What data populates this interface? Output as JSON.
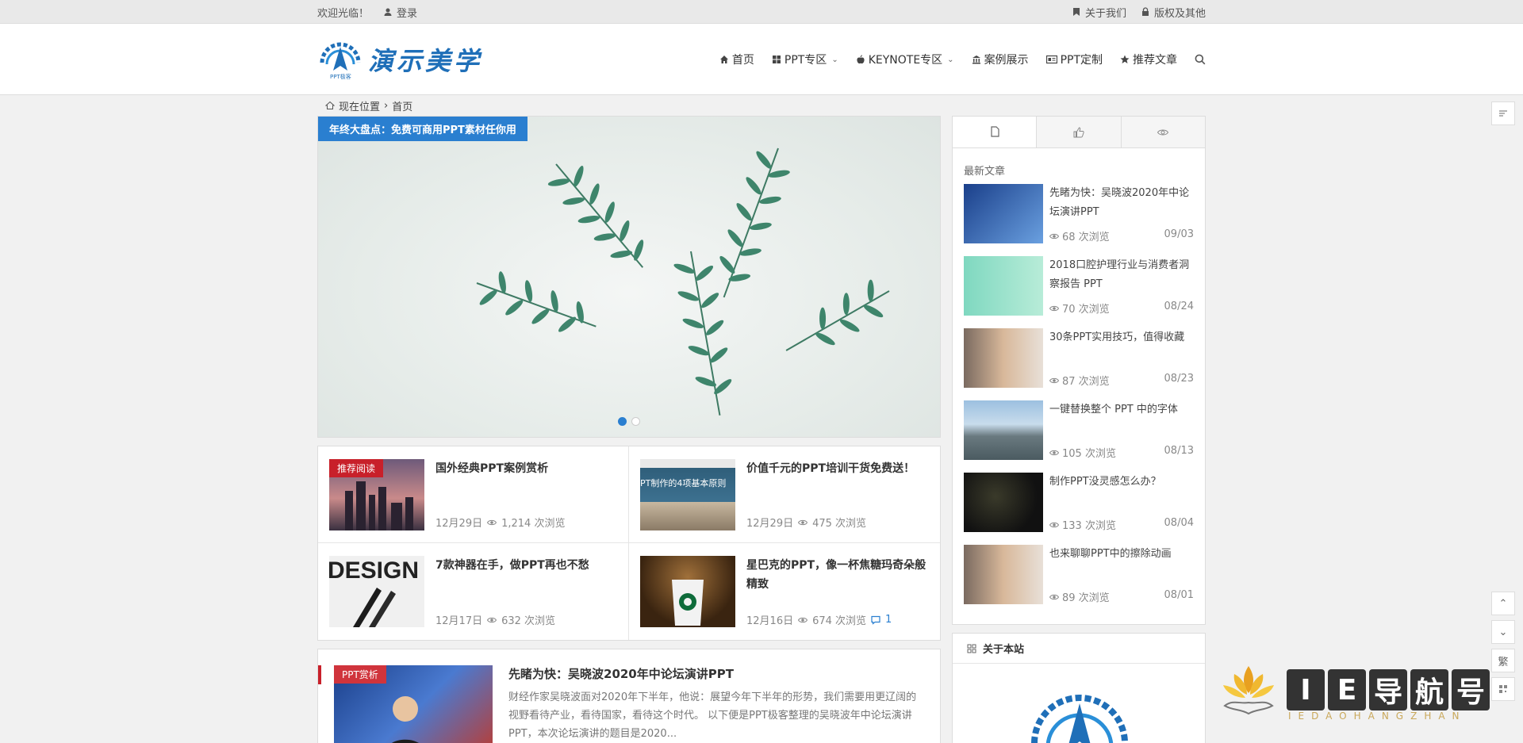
{
  "topbar": {
    "welcome": "欢迎光临！",
    "login": "登录",
    "about_us": "关于我们",
    "copyright": "版权及其他"
  },
  "header": {
    "logo_text": "演示美学",
    "logo_sub": "PPT极客",
    "nav": [
      {
        "label": "首页",
        "icon": "home-icon"
      },
      {
        "label": "PPT专区",
        "icon": "windows-icon",
        "dropdown": true
      },
      {
        "label": "KEYNOTE专区",
        "icon": "apple-icon",
        "dropdown": true
      },
      {
        "label": "案例展示",
        "icon": "bank-icon"
      },
      {
        "label": "PPT定制",
        "icon": "id-card-icon"
      },
      {
        "label": "推荐文章",
        "icon": "star-icon"
      }
    ]
  },
  "breadcrumb": {
    "prefix": "现在位置",
    "sep": "›",
    "current": "首页"
  },
  "slider": {
    "title": "年终大盘点：免费可商用PPT素材任你用"
  },
  "grid_posts": [
    {
      "title": "国外经典PPT案例赏析",
      "date": "12月29日",
      "views": "1,214 次浏览",
      "badge": "推荐阅读"
    },
    {
      "title": "价值千元的PPT培训干货免费送！",
      "date": "12月29日",
      "views": "475 次浏览",
      "thumb_text": "PT制作的4项基本原则"
    },
    {
      "title": "7款神器在手，做PPT再也不愁",
      "date": "12月17日",
      "views": "632 次浏览",
      "thumb_text": "DESIGN"
    },
    {
      "title": "星巴克的PPT，像一杯焦糖玛奇朵般精致",
      "date": "12月16日",
      "views": "674 次浏览",
      "comments": "1"
    }
  ],
  "featured": {
    "badge": "PPT赏析",
    "title": "先睹为快：吴晓波2020年中论坛演讲PPT",
    "excerpt": "财经作家吴晓波面对2020年下半年，他说：展望今年下半年的形势，我们需要用更辽阔的视野看待产业，看待国家，看待这个时代。 以下便是PPT极客整理的吴晓波年中论坛演讲PPT，本次论坛演讲的题目是2020..."
  },
  "sidebar": {
    "heading": "最新文章",
    "posts": [
      {
        "title": "先睹为快：吴晓波2020年中论坛演讲PPT",
        "views": "68 次浏览",
        "date": "09/03"
      },
      {
        "title": "2018口腔护理行业与消费者洞察报告 PPT",
        "views": "70 次浏览",
        "date": "08/24"
      },
      {
        "title": "30条PPT实用技巧，值得收藏",
        "views": "87 次浏览",
        "date": "08/23"
      },
      {
        "title": "一键替换整个 PPT 中的字体",
        "views": "105 次浏览",
        "date": "08/13"
      },
      {
        "title": "制作PPT没灵感怎么办？",
        "views": "133 次浏览",
        "date": "08/04"
      },
      {
        "title": "也来聊聊PPT中的擦除动画",
        "views": "89 次浏览",
        "date": "08/01"
      }
    ],
    "about_title": "关于本站"
  },
  "float": {
    "trad": "繁"
  },
  "watermark": {
    "chars": [
      "I",
      "E",
      "导",
      "航",
      "号"
    ],
    "sub": "IEDAOHANGZHAN"
  },
  "colors": {
    "accent": "#2a7fd0",
    "badge_red": "#c8202a",
    "logo_blue": "#1f6fb8"
  }
}
